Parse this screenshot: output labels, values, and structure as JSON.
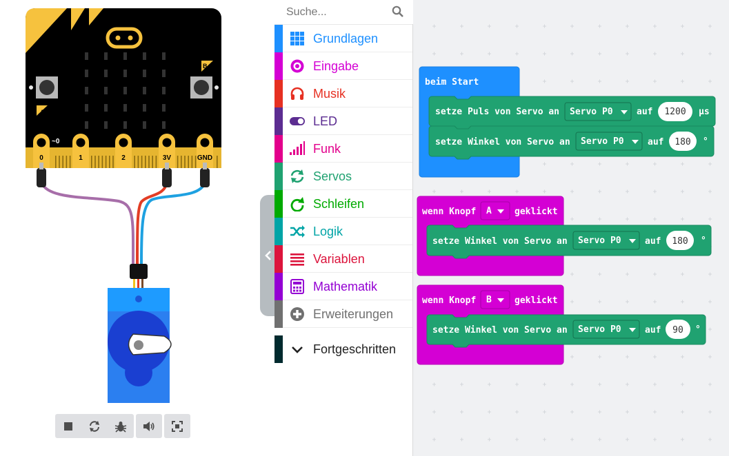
{
  "simulator": {
    "pin_labels": [
      "0",
      "1",
      "2",
      "3V",
      "GND"
    ],
    "pin_tilde": "~0",
    "button_a": "A",
    "button_b": "B",
    "toolbar": [
      {
        "icon": "stop-icon"
      },
      {
        "icon": "restart-icon"
      },
      {
        "icon": "debug-bug-icon"
      },
      {
        "icon": "sound-icon"
      },
      {
        "icon": "screenshot-icon"
      }
    ]
  },
  "toolbox": {
    "search_placeholder": "Suche...",
    "categories": [
      {
        "label": "Grundlagen",
        "color": "#1e90ff",
        "icon": "grid-icon"
      },
      {
        "label": "Eingabe",
        "color": "#d400d4",
        "icon": "radio-target-icon"
      },
      {
        "label": "Musik",
        "color": "#e63022",
        "icon": "headphones-icon"
      },
      {
        "label": "LED",
        "color": "#5c2d91",
        "icon": "toggle-icon"
      },
      {
        "label": "Funk",
        "color": "#e3008c",
        "icon": "signal-bars-icon"
      },
      {
        "label": "Servos",
        "color": "#20a271",
        "icon": "sync-arrows-icon"
      },
      {
        "label": "Schleifen",
        "color": "#00aa00",
        "icon": "loop-arrow-icon"
      },
      {
        "label": "Logik",
        "color": "#00a4a6",
        "icon": "shuffle-icon"
      },
      {
        "label": "Variablen",
        "color": "#dc143c",
        "icon": "list-lines-icon"
      },
      {
        "label": "Mathematik",
        "color": "#9400d3",
        "icon": "calculator-icon"
      },
      {
        "label": "Erweiterungen",
        "color": "#707070",
        "icon": "plus-circle-icon"
      }
    ],
    "advanced": {
      "label": "Fortgeschritten",
      "icon": "chevron-down-icon"
    }
  },
  "workspace": {
    "on_start": {
      "label": "beim Start",
      "color": "#1e90ff",
      "blocks": [
        {
          "text": "setze Puls von Servo an",
          "dropdown": "Servo P0",
          "to": "auf",
          "value": "1200",
          "unit": "µs"
        },
        {
          "text": "setze Winkel von Servo an",
          "dropdown": "Servo P0",
          "to": "auf",
          "value": "180",
          "unit": "°"
        }
      ]
    },
    "button_a": {
      "prefix": "wenn Knopf",
      "button": "A",
      "suffix": "geklickt",
      "color": "#d400d4",
      "block": {
        "text": "setze Winkel von Servo an",
        "dropdown": "Servo P0",
        "to": "auf",
        "value": "180",
        "unit": "°"
      }
    },
    "button_b": {
      "prefix": "wenn Knopf",
      "button": "B",
      "suffix": "geklickt",
      "color": "#d400d4",
      "block": {
        "text": "setze Winkel von Servo an",
        "dropdown": "Servo P0",
        "to": "auf",
        "value": "90",
        "unit": "°"
      }
    },
    "servo_block_color": "#20a271"
  }
}
